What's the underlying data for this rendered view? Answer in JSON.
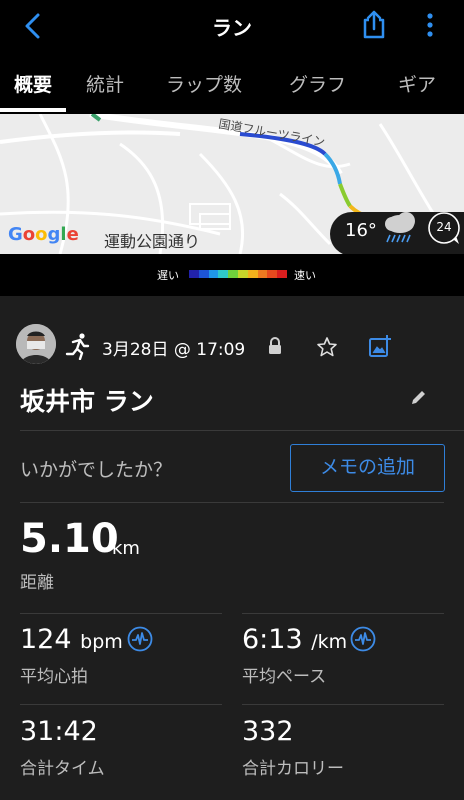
{
  "header": {
    "title": "ラン"
  },
  "tabs": [
    "概要",
    "統計",
    "ラップ数",
    "グラフ",
    "ギア"
  ],
  "map": {
    "road_label_top": "国道フルーツライン",
    "road_label_bottom": "運動公園通り",
    "google_logo": "Google",
    "weather": {
      "temperature": "16°",
      "icon": "rain-cloud-icon",
      "wind": "24"
    }
  },
  "legend": {
    "slow": "遅い",
    "fast": "速い",
    "colors": [
      "#2222aa",
      "#1d55d6",
      "#1f97e8",
      "#2fc8c8",
      "#6fcf3c",
      "#c8d52a",
      "#f3b11c",
      "#ef7a20",
      "#e74a1e",
      "#d91e1e"
    ]
  },
  "activity": {
    "date": "3月28日 @ 17:09",
    "name": "坂井市 ラン",
    "prompt": "いかがでしたか？",
    "memo_button": "メモの追加"
  },
  "stats": {
    "distance": {
      "value": "5.10",
      "unit": "km",
      "label": "距離"
    },
    "avg_hr": {
      "value": "124",
      "unit": "bpm",
      "label": "平均心拍"
    },
    "avg_pace": {
      "value": "6:13",
      "unit": "/km",
      "label": "平均ペース"
    },
    "total_time": {
      "value": "31:42",
      "label": "合計タイム"
    },
    "total_calories": {
      "value": "332",
      "label": "合計カロリー"
    }
  },
  "colors": {
    "accent": "#3d8be6",
    "background": "#1e1e1e"
  }
}
